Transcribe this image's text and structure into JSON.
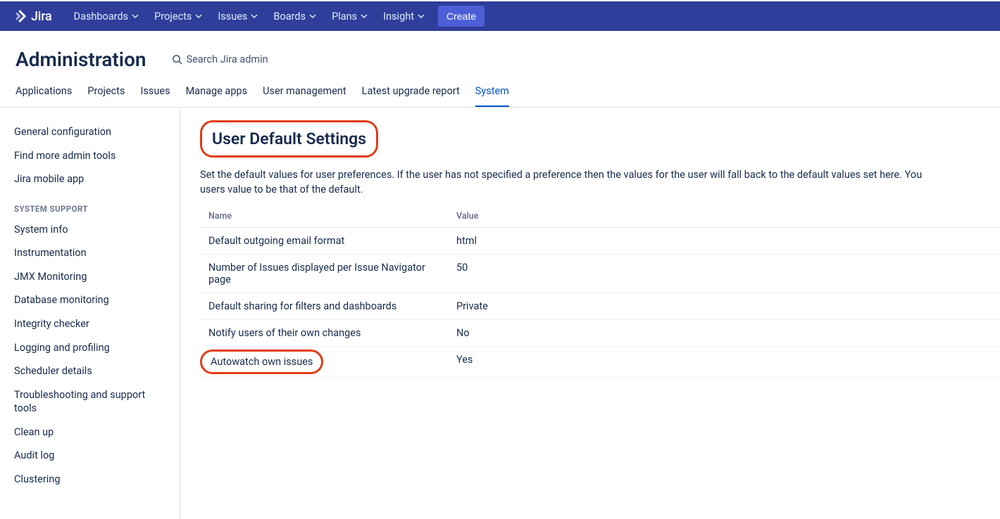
{
  "topnav": {
    "brand": "Jira",
    "items": [
      "Dashboards",
      "Projects",
      "Issues",
      "Boards",
      "Plans",
      "Insight"
    ],
    "create": "Create"
  },
  "admin": {
    "title": "Administration",
    "search_placeholder": "Search Jira admin"
  },
  "tabs": [
    "Applications",
    "Projects",
    "Issues",
    "Manage apps",
    "User management",
    "Latest upgrade report",
    "System"
  ],
  "active_tab_index": 6,
  "sidebar": {
    "top": [
      "General configuration",
      "Find more admin tools",
      "Jira mobile app"
    ],
    "group_title": "SYSTEM SUPPORT",
    "support": [
      "System info",
      "Instrumentation",
      "JMX Monitoring",
      "Database monitoring",
      "Integrity checker",
      "Logging and profiling",
      "Scheduler details",
      "Troubleshooting and support tools",
      "Clean up",
      "Audit log",
      "Clustering"
    ]
  },
  "page": {
    "title": "User Default Settings",
    "desc_line1": "Set the default values for user preferences. If the user has not specified a preference then the values for the user will fall back to the default values set here. You",
    "desc_line2": "users value to be that of the default."
  },
  "table": {
    "col_name": "Name",
    "col_value": "Value",
    "rows": [
      {
        "name": "Default outgoing email format",
        "value": "html",
        "highlight": false
      },
      {
        "name": "Number of Issues displayed per Issue Navigator page",
        "value": "50",
        "highlight": false
      },
      {
        "name": "Default sharing for filters and dashboards",
        "value": "Private",
        "highlight": false
      },
      {
        "name": "Notify users of their own changes",
        "value": "No",
        "highlight": false
      },
      {
        "name": "Autowatch own issues",
        "value": "Yes",
        "highlight": true
      }
    ]
  }
}
